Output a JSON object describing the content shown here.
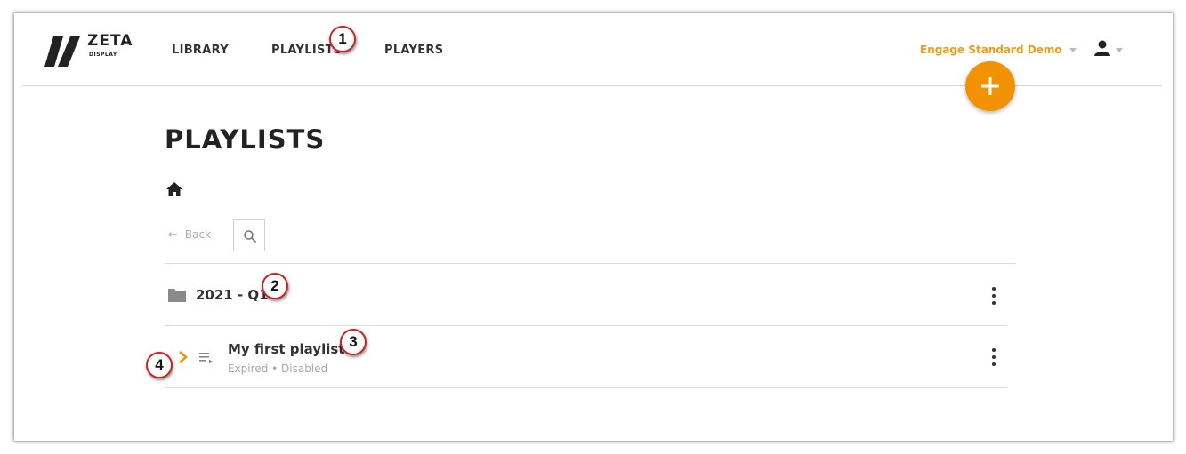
{
  "logo": {
    "word": "ZETA",
    "sub": "DISPLAY"
  },
  "nav": {
    "library": "LIBRARY",
    "playlists": "PLAYLISTS",
    "players": "PLAYERS"
  },
  "account": {
    "name": "Engage Standard Demo"
  },
  "page": {
    "title": "PLAYLISTS"
  },
  "toolbar": {
    "back_label": "Back",
    "back_arrow": "←"
  },
  "folder": {
    "name": "2021 - Q1"
  },
  "playlist": {
    "name": "My first playlist",
    "status": "Expired • Disabled"
  },
  "markers": [
    "1",
    "2",
    "3",
    "4"
  ],
  "colors": {
    "accent": "#f39200",
    "marker_border": "#d62020",
    "text": "#333333",
    "muted": "#a8a8a8"
  },
  "icons": [
    "home-icon",
    "search-icon",
    "folder-icon",
    "playlist-icon",
    "chevron-right-icon",
    "more-vert-icon",
    "user-icon",
    "plus-icon"
  ]
}
